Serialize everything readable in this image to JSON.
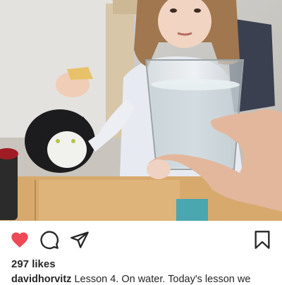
{
  "post": {
    "image_alt": "Girl at a table next to a black and white cat while a hand holds up a glass of water",
    "likes_text": "297 likes",
    "username": "davidhorvitz",
    "caption_text": "Lesson 4. On water. Today's lesson we"
  },
  "actions": {
    "like_icon": "heart-icon",
    "comment_icon": "comment-bubble-icon",
    "share_icon": "paper-plane-icon",
    "save_icon": "bookmark-icon"
  },
  "colors": {
    "like_active": "#ed4956",
    "text": "#262626"
  }
}
